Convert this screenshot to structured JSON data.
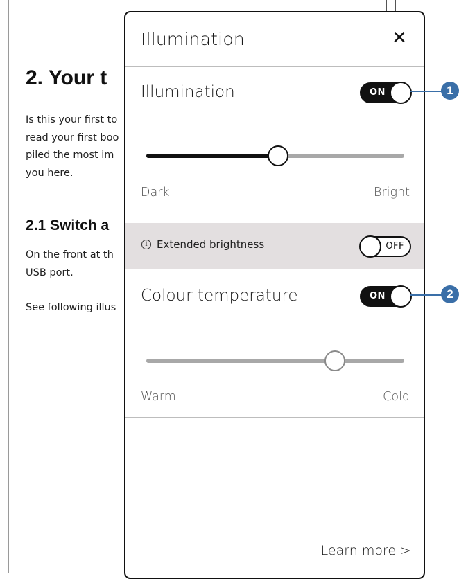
{
  "document": {
    "heading": "2. Your t",
    "paragraph1": [
      "Is this your first to",
      "read your first boo",
      "piled the most im",
      "you here."
    ],
    "subheading": "2.1 Switch a",
    "paragraph2": [
      "On the front at th",
      "USB port."
    ],
    "paragraph3": "See following illus"
  },
  "panel": {
    "title": "Illumination",
    "close_glyph": "✕",
    "illumination": {
      "label": "Illumination",
      "toggle": "ON",
      "slider_level": 0.51,
      "min_label": "Dark",
      "max_label": "Bright"
    },
    "extended": {
      "info_glyph": "i",
      "label": "Extended brightness",
      "toggle": "OFF"
    },
    "colour": {
      "label": "Colour temperature",
      "toggle": "ON",
      "slider_level": 0.73,
      "min_label": "Warm",
      "max_label": "Cold"
    },
    "learn_more": "Learn more >"
  },
  "callouts": [
    "1",
    "2"
  ],
  "colors": {
    "callout": "#3a6fa8",
    "overlay": "#e3dfe0"
  }
}
